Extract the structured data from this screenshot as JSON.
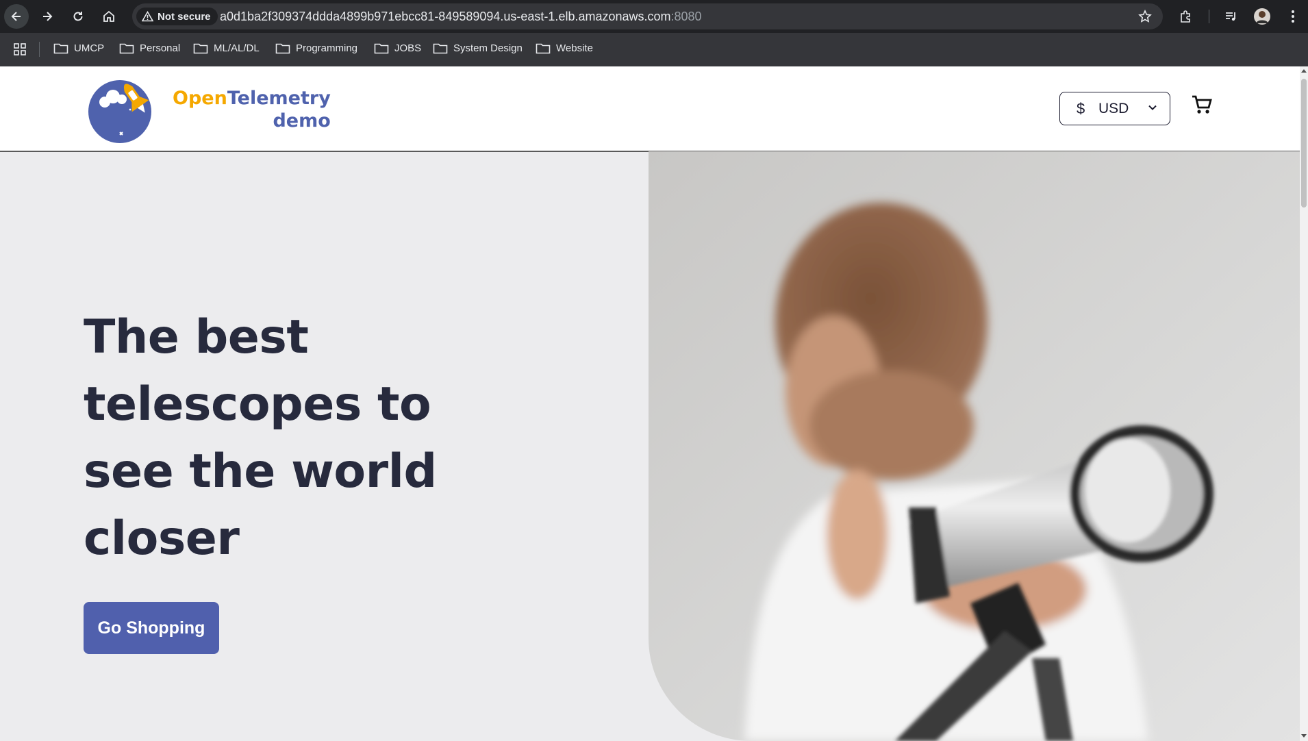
{
  "browser": {
    "security_label": "Not secure",
    "url_host": "a0d1ba2f309374ddda4899b971ebcc81-849589094.us-east-1.elb.amazonaws.com",
    "url_port": ":8080",
    "bookmarks": [
      "UMCP",
      "Personal",
      "ML/AL/DL",
      "Programming",
      "JOBS",
      "System Design",
      "Website"
    ]
  },
  "site": {
    "logo_open": "Open",
    "logo_telemetry": "Telemetry",
    "logo_demo": "demo",
    "currency_symbol": "$",
    "currency_value": "USD",
    "colors": {
      "accent": "#5060ad",
      "logo_orange": "#f5a800",
      "heading": "#272a3d"
    }
  },
  "hero": {
    "title": "The best telescopes to see the world closer",
    "cta_label": "Go Shopping",
    "image_icon": "child-with-telescope-photo"
  }
}
